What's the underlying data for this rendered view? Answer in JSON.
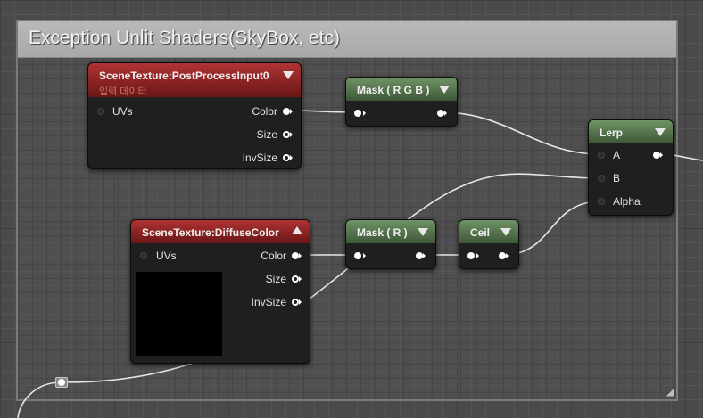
{
  "comment": {
    "title": "Exception Unlit Shaders(SkyBox, etc)"
  },
  "nodes": {
    "post_process": {
      "title": "SceneTexture:PostProcessInput0",
      "subtitle": "입력 데이터",
      "inputs": [
        "UVs"
      ],
      "outputs": [
        "Color",
        "Size",
        "InvSize"
      ]
    },
    "diffuse": {
      "title": "SceneTexture:DiffuseColor",
      "inputs": [
        "UVs"
      ],
      "outputs": [
        "Color",
        "Size",
        "InvSize"
      ]
    },
    "mask_rgb": {
      "title": "Mask ( R G B )"
    },
    "mask_r": {
      "title": "Mask ( R )"
    },
    "ceil": {
      "title": "Ceil"
    },
    "lerp": {
      "title": "Lerp",
      "inputs": [
        "A",
        "B",
        "Alpha"
      ]
    }
  },
  "colors": {
    "header_scene_texture": "#8e2222",
    "header_math": "#5a7a52",
    "wire": "#e6e6e6",
    "graph_bg": "#4a4a4a"
  }
}
